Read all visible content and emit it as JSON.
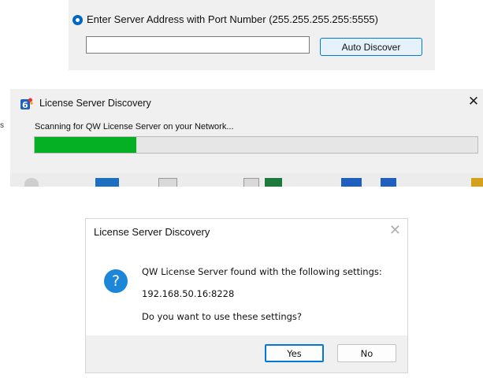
{
  "server_panel": {
    "radio_label": "Enter Server Address with Port Number (255.255.255.255:5555)",
    "address_value": "",
    "auto_discover_label": "Auto Discover"
  },
  "scan_dialog": {
    "title": "License Server Discovery",
    "close_glyph": "✕",
    "message": "Scanning for QW License Server on your Network...",
    "progress": 0.23,
    "progress_color": "#06b025",
    "icon": "app-6-icon",
    "side_letter": "s"
  },
  "found_dialog": {
    "title": "License Server Discovery",
    "close_glyph": "✕",
    "icon": "question-icon",
    "icon_glyph": "?",
    "line1": "QW License Server found with the following settings:",
    "line2": "192.168.50.16:8228",
    "line3": "Do you want to use these settings?",
    "yes_label": "Yes",
    "no_label": "No"
  },
  "colors": {
    "accent": "#0078d7",
    "question_icon": "#1c86d9"
  }
}
